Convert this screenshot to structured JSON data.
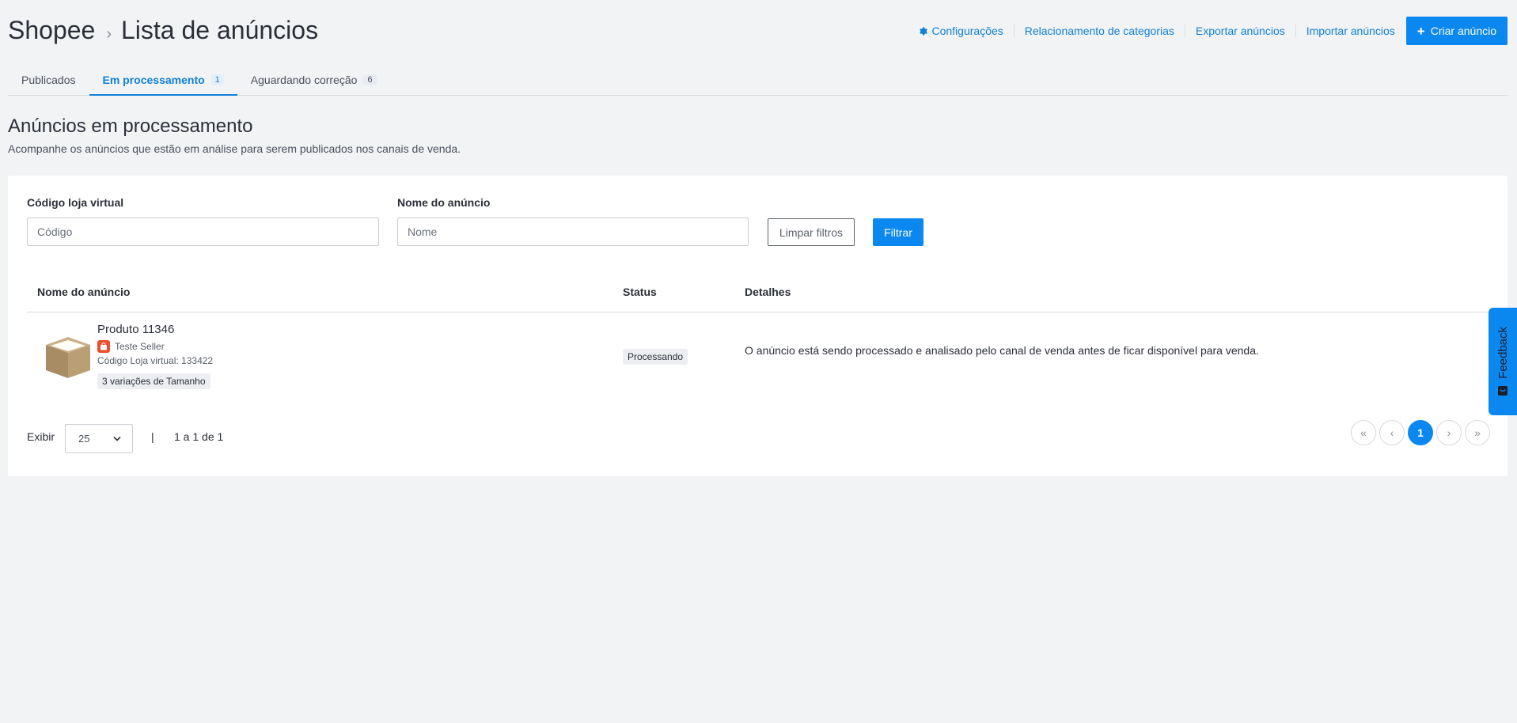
{
  "breadcrumb": {
    "root": "Shopee",
    "separator": "›",
    "current": "Lista de anúncios"
  },
  "actions": {
    "settings": "Configurações",
    "categories": "Relacionamento de categorias",
    "export": "Exportar anúncios",
    "import": "Importar anúncios",
    "create": "Criar anúncio"
  },
  "tabs": [
    {
      "label": "Publicados",
      "count": ""
    },
    {
      "label": "Em processamento",
      "count": "1"
    },
    {
      "label": "Aguardando correção",
      "count": "6"
    }
  ],
  "section": {
    "title": "Anúncios em processamento",
    "subtitle": "Acompanhe os anúncios que estão em análise para serem publicados nos canais de venda."
  },
  "filters": {
    "code_label": "Código loja virtual",
    "code_placeholder": "Código",
    "name_label": "Nome do anúncio",
    "name_placeholder": "Nome",
    "clear": "Limpar filtros",
    "filter": "Filtrar"
  },
  "table": {
    "headers": [
      "Nome do anúncio",
      "Status",
      "Detalhes"
    ],
    "rows": [
      {
        "name": "Produto 11346",
        "seller": "Teste Seller",
        "code": "Código Loja virtual: 133422",
        "variations": "3 variações de Tamanho",
        "status": "Processando",
        "details": "O anúncio está sendo processado e analisado pelo canal de venda antes de ficar disponível para venda."
      }
    ]
  },
  "pagination": {
    "show_label": "Exibir",
    "per_page": "25",
    "separator": "|",
    "range": "1 a 1 de 1",
    "first": "«",
    "prev": "‹",
    "current": "1",
    "next": "›",
    "last": "»"
  },
  "feedback": {
    "label": "Feedback"
  },
  "colors": {
    "accent": "#0b87f0",
    "shopee": "#ee4d2d"
  }
}
